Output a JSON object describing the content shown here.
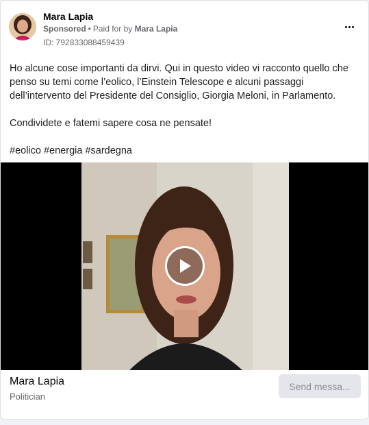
{
  "ad": {
    "advertiser_name": "Mara Lapia",
    "sponsored_label": "Sponsored",
    "separator": "•",
    "paid_for_prefix": "Paid for by",
    "paid_for_name": "Mara Lapia",
    "ad_id": "ID: 792833088459439",
    "body_paragraphs": [
      "Ho alcune cose importanti da dirvi. Qui in questo video vi racconto quello che penso su temi come l’eolico, l’Einstein Telescope e alcuni passaggi dell’intervento del Presidente del Consiglio, Giorgia Meloni, in Parlamento.",
      "Condividete e fatemi sapere cosa ne pensate!",
      "#eolico #energia #sardegna"
    ]
  },
  "video": {
    "play_icon": "play-icon"
  },
  "footer": {
    "page_name": "Mara Lapia",
    "page_category": "Politician",
    "cta_label": "Send messa..."
  },
  "colors": {
    "secondary_text": "#65676b",
    "button_bg": "#e4e6eb",
    "button_text": "#8a8d91"
  }
}
